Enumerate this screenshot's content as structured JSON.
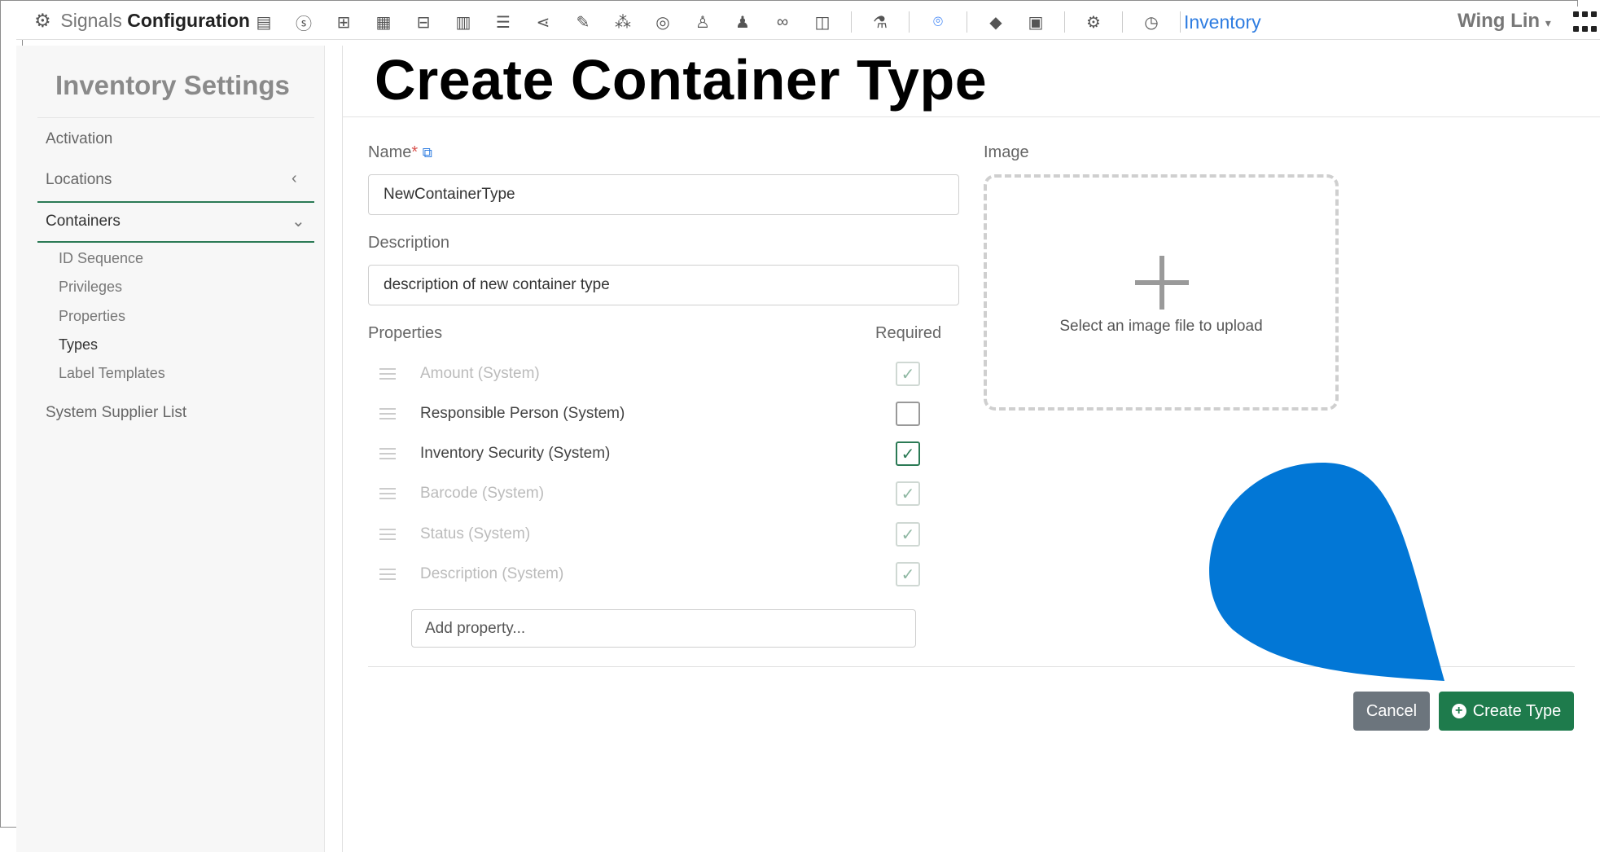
{
  "header": {
    "brand_prefix": "Signals",
    "brand_name": "Configuration",
    "module_link": "Inventory",
    "user_name": "Wing Lin"
  },
  "sidebar": {
    "title": "Inventory Settings",
    "items": [
      {
        "label": "Activation"
      },
      {
        "label": "Locations"
      },
      {
        "label": "Containers"
      },
      {
        "label": "System Supplier List"
      }
    ],
    "sub_items": [
      {
        "label": "ID Sequence"
      },
      {
        "label": "Privileges"
      },
      {
        "label": "Properties"
      },
      {
        "label": "Types",
        "active": true
      },
      {
        "label": "Label Templates"
      }
    ]
  },
  "main": {
    "title": "Create Container Type",
    "name_label": "Name",
    "name_required_mark": "*",
    "name_value": "NewContainerType",
    "description_label": "Description",
    "description_value": "description of new container type",
    "properties_label": "Properties",
    "required_label": "Required",
    "properties": [
      {
        "label": "Amount (System)",
        "enabled": false,
        "required": true
      },
      {
        "label": "Responsible Person (System)",
        "enabled": true,
        "required": false
      },
      {
        "label": "Inventory Security (System)",
        "enabled": true,
        "required": true
      },
      {
        "label": "Barcode (System)",
        "enabled": false,
        "required": true
      },
      {
        "label": "Status (System)",
        "enabled": false,
        "required": true
      },
      {
        "label": "Description (System)",
        "enabled": false,
        "required": true
      }
    ],
    "add_property_placeholder": "Add property...",
    "image_label": "Image",
    "image_upload_text": "Select an image file to upload",
    "cancel_label": "Cancel",
    "create_label": "Create Type"
  },
  "colors": {
    "accent_green": "#1e7b4c",
    "link_blue": "#2f7de1",
    "annotation_blue": "#0277d6"
  }
}
